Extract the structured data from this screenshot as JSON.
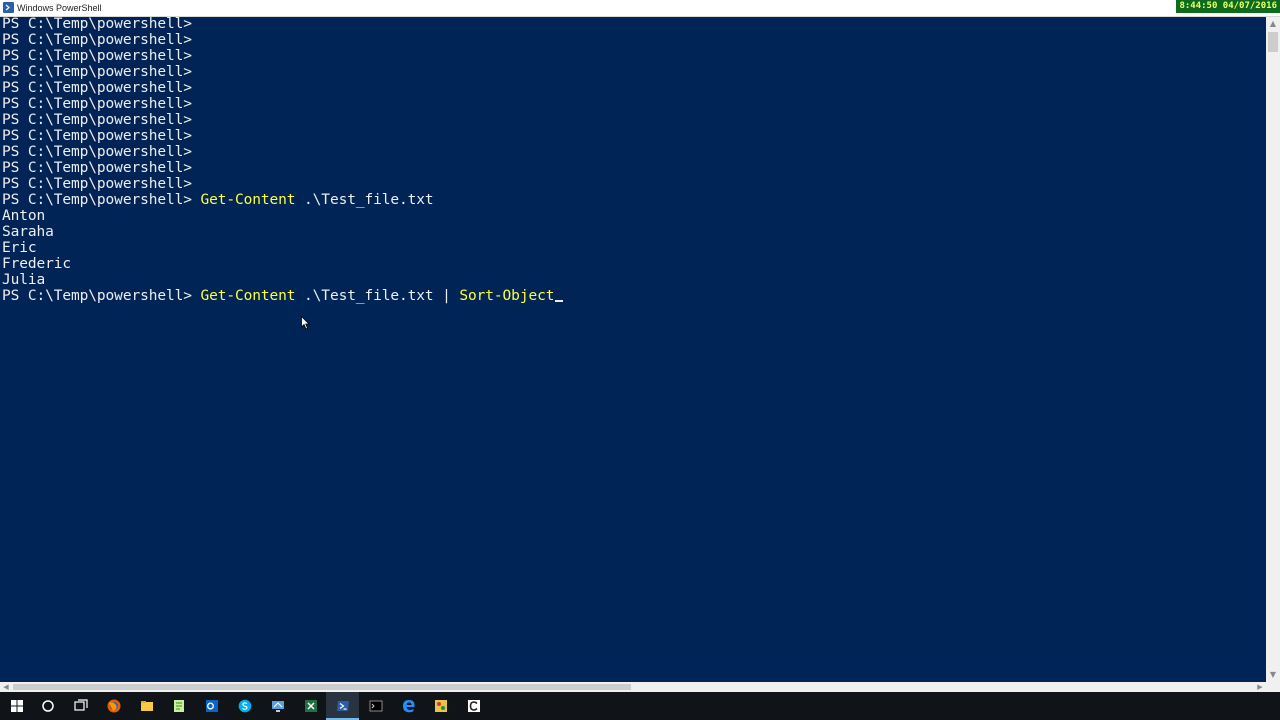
{
  "window": {
    "title": "Windows PowerShell",
    "clock": "8:44:50 04/07/2016"
  },
  "console": {
    "prompt": "PS C:\\Temp\\powershell>",
    "empty_prompt_count": 11,
    "command1": {
      "cmdlet": "Get-Content",
      "argument": ".\\Test_file.txt"
    },
    "output": [
      "Anton",
      "Saraha",
      "Eric",
      "Frederic",
      "Julia"
    ],
    "command2": {
      "cmdlet": "Get-Content",
      "argument": ".\\Test_file.txt",
      "pipe": "|",
      "cmdlet2": "Sort-Object"
    }
  },
  "colors": {
    "background": "#012456",
    "text": "#eeedf0",
    "cmdlet": "#ffff3c"
  },
  "taskbar": {
    "items": [
      {
        "icon": "windows-start-icon"
      },
      {
        "icon": "cortana-search-icon"
      },
      {
        "icon": "task-view-icon"
      },
      {
        "icon": "firefox-icon"
      },
      {
        "icon": "file-explorer-icon"
      },
      {
        "icon": "notepadplusplus-icon"
      },
      {
        "icon": "outlook-icon"
      },
      {
        "icon": "skype-icon"
      },
      {
        "icon": "remote-desktop-icon"
      },
      {
        "icon": "excel-icon"
      },
      {
        "icon": "powershell-icon",
        "active": true
      },
      {
        "icon": "command-prompt-icon"
      },
      {
        "icon": "edge-icon"
      },
      {
        "icon": "paint-icon"
      },
      {
        "icon": "ccleaner-icon"
      }
    ]
  }
}
